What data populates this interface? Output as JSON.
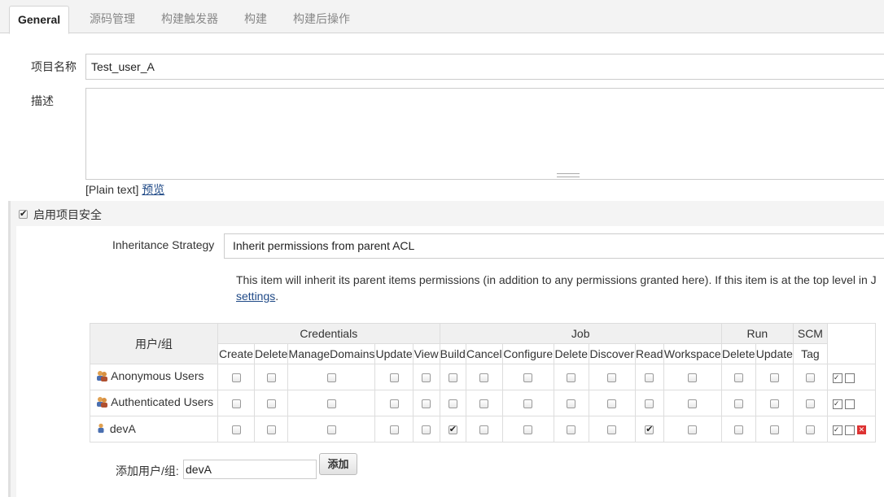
{
  "tabs": [
    {
      "label": "General",
      "active": true
    },
    {
      "label": "源码管理"
    },
    {
      "label": "构建触发器"
    },
    {
      "label": "构建"
    },
    {
      "label": "构建后操作"
    }
  ],
  "project_name": {
    "label": "项目名称",
    "value": "Test_user_A"
  },
  "description": {
    "label": "描述",
    "value": "",
    "format_text": "[Plain text]",
    "preview_link": "预览"
  },
  "security": {
    "checkbox_label": "启用项目安全",
    "checked": true
  },
  "inheritance": {
    "label": "Inheritance Strategy",
    "value": "Inherit permissions from parent ACL",
    "help_text": "This item will inherit its parent items permissions (in addition to any permissions granted here). If this item is at the top level in J",
    "help_link": "settings",
    "help_tail": "."
  },
  "matrix": {
    "user_header": "用户/组",
    "groups": [
      {
        "name": "Credentials"
      },
      {
        "name": "Job"
      },
      {
        "name": "Run"
      },
      {
        "name": "SCM"
      }
    ],
    "perms": [
      "Create",
      "Delete",
      "ManageDomains",
      "Update",
      "View",
      "Build",
      "Cancel",
      "Configure",
      "Delete",
      "Discover",
      "Read",
      "Workspace",
      "Delete",
      "Update",
      "Tag"
    ],
    "rows": [
      {
        "name": "Anonymous Users",
        "type": "group",
        "checked": []
      },
      {
        "name": "Authenticated Users",
        "type": "group",
        "checked": []
      },
      {
        "name": "devA",
        "type": "user",
        "checked": [
          5,
          10
        ]
      }
    ]
  },
  "add_user": {
    "label": "添加用户/组:",
    "value": "devA",
    "button": "添加"
  }
}
